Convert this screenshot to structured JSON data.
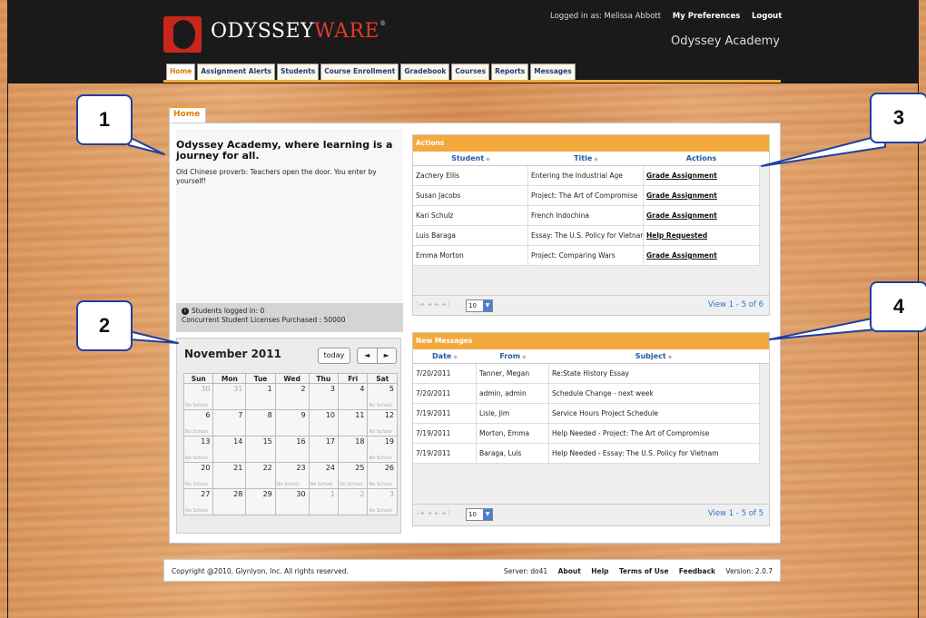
{
  "header": {
    "logo_odyssey": "ODYSSEY",
    "logo_ware": "WARE",
    "logo_reg": "®",
    "logged_in_as": "Logged in as: Melissa Abbott",
    "my_preferences": "My Preferences",
    "logout": "Logout",
    "school": "Odyssey Academy"
  },
  "tabs": [
    "Home",
    "Assignment Alerts",
    "Students",
    "Course Enrollment",
    "Gradebook",
    "Courses",
    "Reports",
    "Messages"
  ],
  "home_tab": "Home",
  "intro": {
    "title": "Odyssey Academy, where learning is a journey for all.",
    "text": "Old Chinese proverb: Teachers open the door. You enter by yourself!"
  },
  "login_status": {
    "icon": "info-icon",
    "logged_in": "Students logged in: 0",
    "licenses": "Concurrent Student Licenses Purchased : 50000"
  },
  "calendar": {
    "month": "November 2011",
    "today": "today",
    "prev": "◄",
    "next": "►",
    "no_school": "No School",
    "days": [
      "Sun",
      "Mon",
      "Tue",
      "Wed",
      "Thu",
      "Fri",
      "Sat"
    ],
    "weeks": [
      [
        {
          "d": "30",
          "o": true,
          "ns": true
        },
        {
          "d": "31",
          "o": true
        },
        {
          "d": "1"
        },
        {
          "d": "2"
        },
        {
          "d": "3"
        },
        {
          "d": "4"
        },
        {
          "d": "5",
          "ns": true
        }
      ],
      [
        {
          "d": "6",
          "ns": true
        },
        {
          "d": "7"
        },
        {
          "d": "8"
        },
        {
          "d": "9"
        },
        {
          "d": "10"
        },
        {
          "d": "11"
        },
        {
          "d": "12",
          "ns": true
        }
      ],
      [
        {
          "d": "13",
          "ns": true
        },
        {
          "d": "14"
        },
        {
          "d": "15"
        },
        {
          "d": "16"
        },
        {
          "d": "17"
        },
        {
          "d": "18"
        },
        {
          "d": "19",
          "ns": true
        }
      ],
      [
        {
          "d": "20",
          "ns": true
        },
        {
          "d": "21"
        },
        {
          "d": "22"
        },
        {
          "d": "23",
          "ns": true
        },
        {
          "d": "24",
          "ns": true
        },
        {
          "d": "25",
          "ns": true
        },
        {
          "d": "26",
          "ns": true
        }
      ],
      [
        {
          "d": "27",
          "ns": true
        },
        {
          "d": "28"
        },
        {
          "d": "29"
        },
        {
          "d": "30"
        },
        {
          "d": "1",
          "o": true
        },
        {
          "d": "2",
          "o": true
        },
        {
          "d": "3",
          "o": true,
          "ns": true
        }
      ]
    ]
  },
  "actions": {
    "header": "Actions",
    "columns": [
      "Student",
      "Title",
      "Actions"
    ],
    "rows": [
      [
        "Zachery Ellis",
        "Entering the Industrial Age",
        "Grade Assignment"
      ],
      [
        "Susan Jacobs",
        "Project: The Art of Compromise",
        "Grade Assignment"
      ],
      [
        "Kari Schulz",
        "French Indochina",
        "Grade Assignment"
      ],
      [
        "Luis Baraga",
        "Essay: The U.S. Policy for Vietnam",
        "Help Requested"
      ],
      [
        "Emma Morton",
        "Project: Comparing Wars",
        "Grade Assignment"
      ]
    ],
    "page_size": "10",
    "view": "View 1 - 5 of 6"
  },
  "messages": {
    "header": "New Messages",
    "columns": [
      "Date",
      "From",
      "Subject"
    ],
    "rows": [
      [
        "7/20/2011",
        "Tanner, Megan",
        "Re:State History Essay"
      ],
      [
        "7/20/2011",
        "admin, admin",
        "Schedule Change - next week"
      ],
      [
        "7/19/2011",
        "Lisle, Jim",
        "Service Hours Project Schedule"
      ],
      [
        "7/19/2011",
        "Morton, Emma",
        "Help Needed - Project: The Art of Compromise"
      ],
      [
        "7/19/2011",
        "Baraga, Luis",
        "Help Needed - Essay: The U.S. Policy for Vietnam"
      ]
    ],
    "page_size": "10",
    "view": "View 1 - 5 of 5"
  },
  "footer": {
    "copyright": "Copyright @2010, Glynlyon, Inc. All rights reserved.",
    "server": "Server: do41",
    "about": "About",
    "help": "Help",
    "terms": "Terms of Use",
    "feedback": "Feedback",
    "version": "Version: 2.0.7"
  },
  "callouts": [
    "1",
    "2",
    "3",
    "4"
  ],
  "colors": {
    "accent": "#f4a93c",
    "link": "#1f5ca6",
    "callout_border": "#1f3fa0",
    "brand_red": "#e23a2a"
  }
}
